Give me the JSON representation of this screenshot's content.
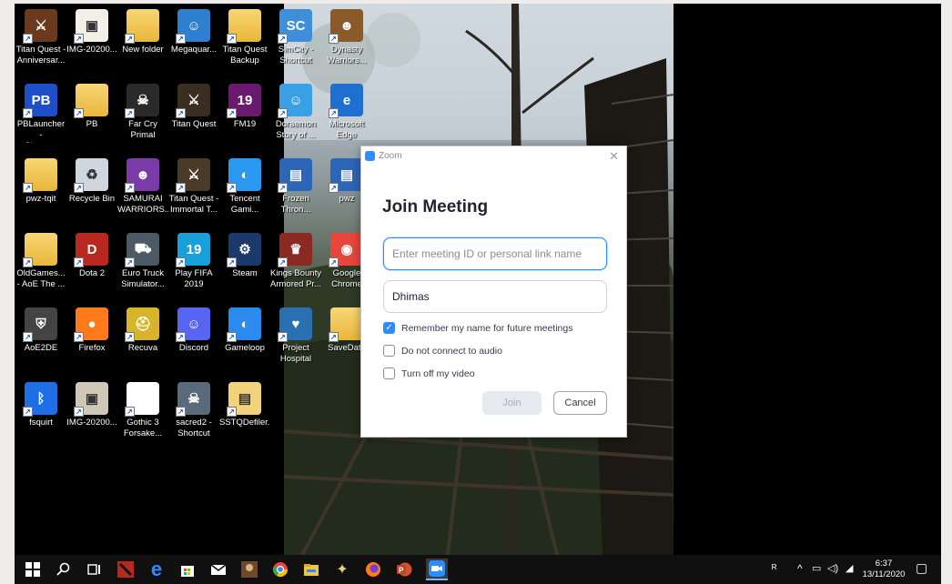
{
  "desktop": {
    "icons": [
      {
        "label": "Titan Quest -\nAnniversar...",
        "icon": "titan-quest-anniversary-icon",
        "color": "#6b3a1c",
        "glyph": "⚔"
      },
      {
        "label": "IMG-20200...",
        "icon": "image-file-icon",
        "color": "#f2f0e8",
        "glyph": "▣"
      },
      {
        "label": "New folder",
        "icon": "folder-icon",
        "color": "",
        "glyph": ""
      },
      {
        "label": "Megaquar...",
        "icon": "megaquarium-icon",
        "color": "#2f7fd1",
        "glyph": "☺"
      },
      {
        "label": "Titan Quest\nBackup",
        "icon": "folder-icon",
        "color": "",
        "glyph": ""
      },
      {
        "label": "SimCity -\nShortcut",
        "icon": "simcity-icon",
        "color": "#3f8fd8",
        "glyph": "SC"
      },
      {
        "label": "Dynasty\nWarriors...",
        "icon": "dynasty-warriors-icon",
        "color": "#8a5a2b",
        "glyph": "☻"
      },
      {
        "label": "PBLauncher -\nShortcut",
        "icon": "pb-launcher-icon",
        "color": "#1f4fc8",
        "glyph": "PB"
      },
      {
        "label": "PB",
        "icon": "folder-icon",
        "color": "",
        "glyph": ""
      },
      {
        "label": "Far Cry\nPrimal",
        "icon": "far-cry-primal-icon",
        "color": "#2a2a2a",
        "glyph": "☠"
      },
      {
        "label": "Titan Quest",
        "icon": "titan-quest-icon",
        "color": "#3a2e22",
        "glyph": "⚔"
      },
      {
        "label": "FM19",
        "icon": "fm19-icon",
        "color": "#6a1a6e",
        "glyph": "19"
      },
      {
        "label": "Doraemon\nStory of ...",
        "icon": "doraemon-icon",
        "color": "#3aa0e6",
        "glyph": "☺"
      },
      {
        "label": "Microsoft\nEdge",
        "icon": "edge-icon",
        "color": "#1f6fd0",
        "glyph": "e"
      },
      {
        "label": "pwz-tqit",
        "icon": "folder-icon",
        "color": "",
        "glyph": ""
      },
      {
        "label": "Recycle Bin",
        "icon": "recycle-bin-icon",
        "color": "#cfd6dd",
        "glyph": "♻"
      },
      {
        "label": "SAMURAI\nWARRIORS...",
        "icon": "samurai-warriors-icon",
        "color": "#7a3aa8",
        "glyph": "☻"
      },
      {
        "label": "Titan Quest -\nImmortal T...",
        "icon": "titan-quest-immortal-icon",
        "color": "#4a3a28",
        "glyph": "⚔"
      },
      {
        "label": "Tencent\nGami...",
        "icon": "tencent-gaming-icon",
        "color": "#2a9af0",
        "glyph": "◐"
      },
      {
        "label": "Frozen\nThron...",
        "icon": "frozen-throne-icon",
        "color": "#2d66b8",
        "glyph": "▤"
      },
      {
        "label": "pwz",
        "icon": "document-icon",
        "color": "#2d66b8",
        "glyph": "▤"
      },
      {
        "label": "OldGames...\n- AoE The ...",
        "icon": "folder-icon",
        "color": "",
        "glyph": ""
      },
      {
        "label": "Dota 2",
        "icon": "dota2-icon",
        "color": "#b8281e",
        "glyph": "D"
      },
      {
        "label": "Euro Truck\nSimulator...",
        "icon": "euro-truck-icon",
        "color": "#4d5a66",
        "glyph": "⛟"
      },
      {
        "label": "Play FIFA\n2019",
        "icon": "fifa-icon",
        "color": "#1aa0d8",
        "glyph": "19"
      },
      {
        "label": "Steam",
        "icon": "steam-icon",
        "color": "#1b3a6b",
        "glyph": "⚙"
      },
      {
        "label": "Kings Bounty\nArmored Pr...",
        "icon": "kings-bounty-icon",
        "color": "#8a2a22",
        "glyph": "♛"
      },
      {
        "label": "Google\nChrome",
        "icon": "chrome-icon",
        "color": "#e8453c",
        "glyph": "◉"
      },
      {
        "label": "AoE2DE",
        "icon": "aoe2de-icon",
        "color": "#444",
        "glyph": "⛨"
      },
      {
        "label": "Firefox",
        "icon": "firefox-icon",
        "color": "#ff7a1a",
        "glyph": "●"
      },
      {
        "label": "Recuva",
        "icon": "recuva-icon",
        "color": "#d8b42a",
        "glyph": "⛑"
      },
      {
        "label": "Discord",
        "icon": "discord-icon",
        "color": "#5865f2",
        "glyph": "☺"
      },
      {
        "label": "Gameloop",
        "icon": "gameloop-icon",
        "color": "#2a8af0",
        "glyph": "◐"
      },
      {
        "label": "Project\nHospital",
        "icon": "project-hospital-icon",
        "color": "#2a6fb0",
        "glyph": "♥"
      },
      {
        "label": "SaveData",
        "icon": "folder-icon",
        "color": "",
        "glyph": ""
      },
      {
        "label": "fsquirt",
        "icon": "bluetooth-icon",
        "color": "#1e6fe6",
        "glyph": "ᛒ"
      },
      {
        "label": "IMG-20200...",
        "icon": "image-file-icon",
        "color": "#cfc8b8",
        "glyph": "▣"
      },
      {
        "label": "Gothic 3\nForsake...",
        "icon": "blank-file-icon",
        "color": "#ffffff",
        "glyph": ""
      },
      {
        "label": "sacred2 -\nShortcut",
        "icon": "sacred2-icon",
        "color": "#5a6a7a",
        "glyph": "☠"
      },
      {
        "label": "SSTQDefiler...",
        "icon": "sstq-file-icon",
        "color": "#f2d27a",
        "glyph": "▤"
      }
    ]
  },
  "zoom": {
    "window_title": "Zoom",
    "heading": "Join Meeting",
    "meeting_id_placeholder": "Enter meeting ID or personal link name",
    "name_value": "Dhimas",
    "options": [
      {
        "label": "Remember my name for future meetings",
        "checked": true
      },
      {
        "label": "Do not connect to audio",
        "checked": false
      },
      {
        "label": "Turn off my video",
        "checked": false
      }
    ],
    "join_label": "Join",
    "cancel_label": "Cancel",
    "accent": "#2d8cff"
  },
  "taskbar": {
    "time": "6:37",
    "date": "13/11/2020"
  }
}
